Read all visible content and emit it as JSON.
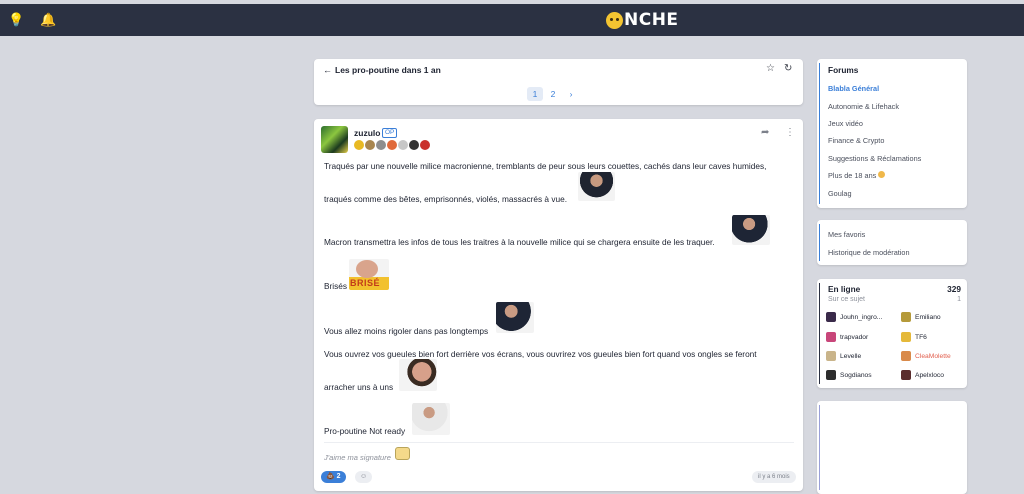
{
  "app": {
    "logo_text": "NCHE"
  },
  "topbar": {
    "left_icons": [
      "lightbulb-icon",
      "bell-icon"
    ]
  },
  "topic": {
    "title": "Les pro-poutine dans 1 an",
    "pages": [
      "1",
      "2"
    ],
    "current_page": "1",
    "next_symbol": "›"
  },
  "post": {
    "author": "zuzulo",
    "author_tag": "OP",
    "badge_colors": [
      "#e8b923",
      "#a8864f",
      "#8e8e8e",
      "#e06a3b",
      "#c7c7c7",
      "#333333",
      "#c9302c"
    ],
    "lines": [
      "Traqués par une nouvelle milice macronienne, tremblants de peur sous leurs couettes, cachés dans leur caves humides,",
      "traqués comme des bêtes, emprisonnés, violés, massacrés à vue.",
      "Macron transmettra les infos de tous les traitres à la nouvelle milice qui se chargera ensuite de les traquer.",
      "Brisés",
      "Vous allez moins rigoler dans pas longtemps",
      "Vous ouvrez vos gueules bien fort derrière vos écrans, vous ouvrirez vos gueules bien fort quand vos ongles se feront",
      "arracher uns à uns",
      "Pro-poutine Not ready"
    ],
    "sticker_text": "BRISÉ",
    "signature": "J'aime ma signature",
    "reaction_count": "2",
    "age": "il y a 6 mois"
  },
  "forums": {
    "title": "Forums",
    "items": [
      {
        "label": "Blabla Général",
        "active": true
      },
      {
        "label": "Autonomie & Lifehack",
        "active": false
      },
      {
        "label": "Jeux vidéo",
        "active": false
      },
      {
        "label": "Finance & Crypto",
        "active": false
      },
      {
        "label": "Suggestions & Réclamations",
        "active": false
      },
      {
        "label": "Plus de 18 ans",
        "active": false
      },
      {
        "label": "Goulag",
        "active": false
      }
    ]
  },
  "links": {
    "favorites": "Mes favoris",
    "moderation": "Historique de modération"
  },
  "online": {
    "title": "En ligne",
    "count": "329",
    "subject_label": "Sur ce sujet",
    "subject_count": "1",
    "users": [
      {
        "name": "Jouhn_ingro...",
        "color": "#3a2a4a"
      },
      {
        "name": "Emiliano",
        "color": "#b59a3a"
      },
      {
        "name": "trapvador",
        "color": "#c8467a"
      },
      {
        "name": "TF6",
        "color": "#e5b93a"
      },
      {
        "name": "Levelle",
        "color": "#c9b48a"
      },
      {
        "name": "CleaMolette",
        "color": "#d98a4a",
        "highlight": true
      },
      {
        "name": "Sogdianos",
        "color": "#2d2d2d"
      },
      {
        "name": "Apelxloco",
        "color": "#5a2d2d"
      }
    ]
  }
}
